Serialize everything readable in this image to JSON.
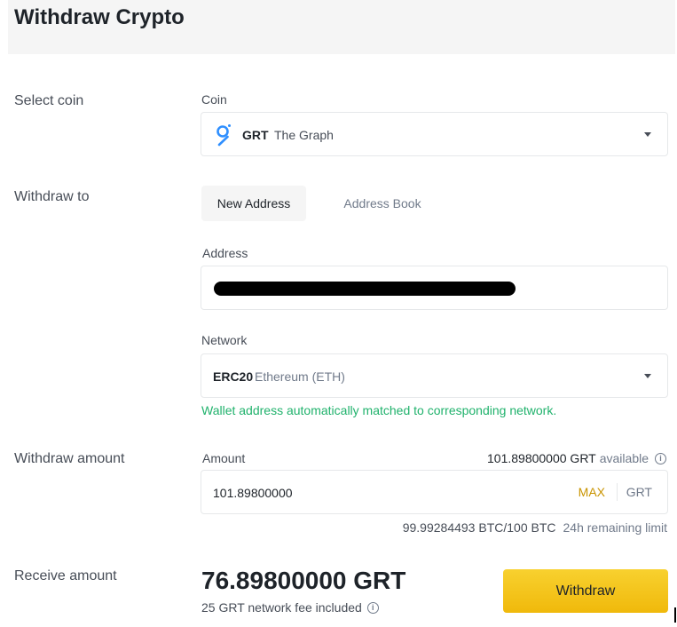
{
  "page_title": "Withdraw Crypto",
  "select_coin": {
    "row_label": "Select coin",
    "field_label": "Coin",
    "selected_symbol": "GRT",
    "selected_name": "The Graph",
    "icon": "the-graph-icon"
  },
  "withdraw_to": {
    "row_label": "Withdraw to",
    "tabs": [
      {
        "label": "New Address",
        "active": true
      },
      {
        "label": "Address Book",
        "active": false
      }
    ],
    "address_label": "Address",
    "address_redacted": true,
    "network_label": "Network",
    "network_code": "ERC20",
    "network_name": "Ethereum (ETH)",
    "match_message": "Wallet address automatically matched to corresponding network."
  },
  "withdraw_amount": {
    "row_label": "Withdraw amount",
    "field_label": "Amount",
    "available_amount": "101.89800000 GRT",
    "available_suffix": "available",
    "value": "101.89800000",
    "max_label": "MAX",
    "unit": "GRT",
    "limit_value": "99.99284493 BTC/100 BTC",
    "limit_label": "24h remaining limit"
  },
  "receive_amount": {
    "row_label": "Receive amount",
    "value": "76.89800000 GRT",
    "fee_note": "25 GRT network fee included",
    "withdraw_button": "Withdraw"
  },
  "colors": {
    "accent": "#f0b90b",
    "success": "#20b26c",
    "max": "#c99400"
  }
}
